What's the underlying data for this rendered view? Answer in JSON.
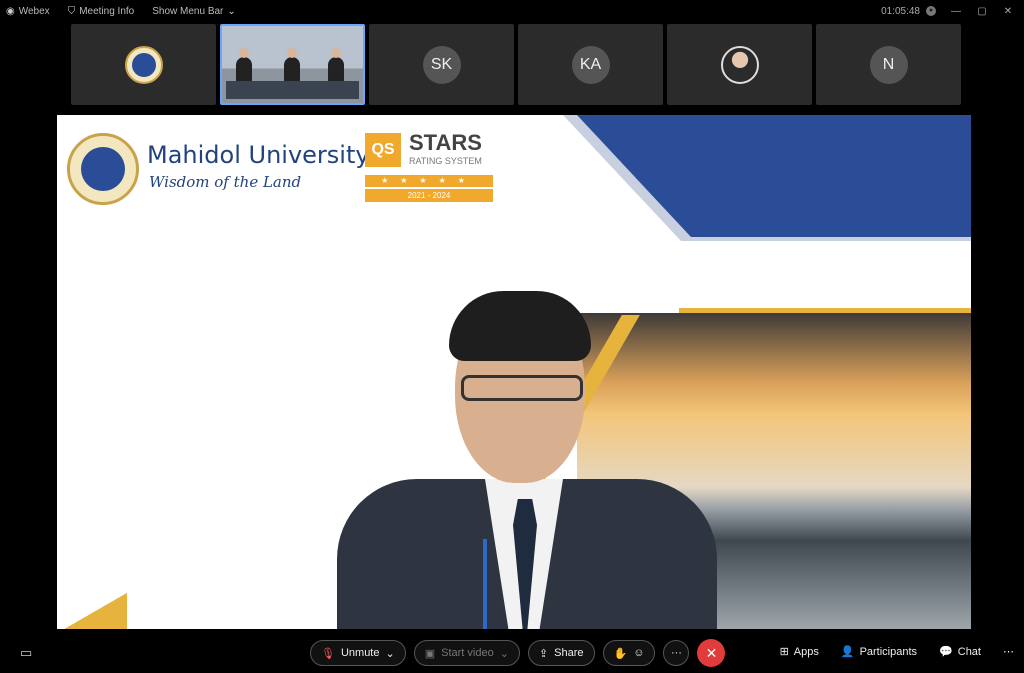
{
  "topbar": {
    "app_name": "Webex",
    "meeting_info": "Meeting Info",
    "show_menu": "Show Menu Bar",
    "timer": "01:05:48"
  },
  "participants": [
    {
      "type": "logo",
      "label": ""
    },
    {
      "type": "video",
      "label": ""
    },
    {
      "type": "initials",
      "label": "SK"
    },
    {
      "type": "initials",
      "label": "KA"
    },
    {
      "type": "photo",
      "label": ""
    },
    {
      "type": "initials",
      "label": "N"
    }
  ],
  "slide": {
    "university": "Mahidol University",
    "tagline": "Wisdom of the Land",
    "qs_logo": "QS",
    "stars_title": "STARS",
    "stars_subtitle": "RATING SYSTEM",
    "stars": "★★★★★",
    "stars_years": "2021 - 2024",
    "colors": {
      "navy": "#23437e",
      "band": "#2b4c96",
      "gold": "#e6b43d"
    }
  },
  "controls": {
    "unmute": "Unmute",
    "start_video": "Start video",
    "share": "Share",
    "apps": "Apps",
    "participants": "Participants",
    "chat": "Chat"
  }
}
